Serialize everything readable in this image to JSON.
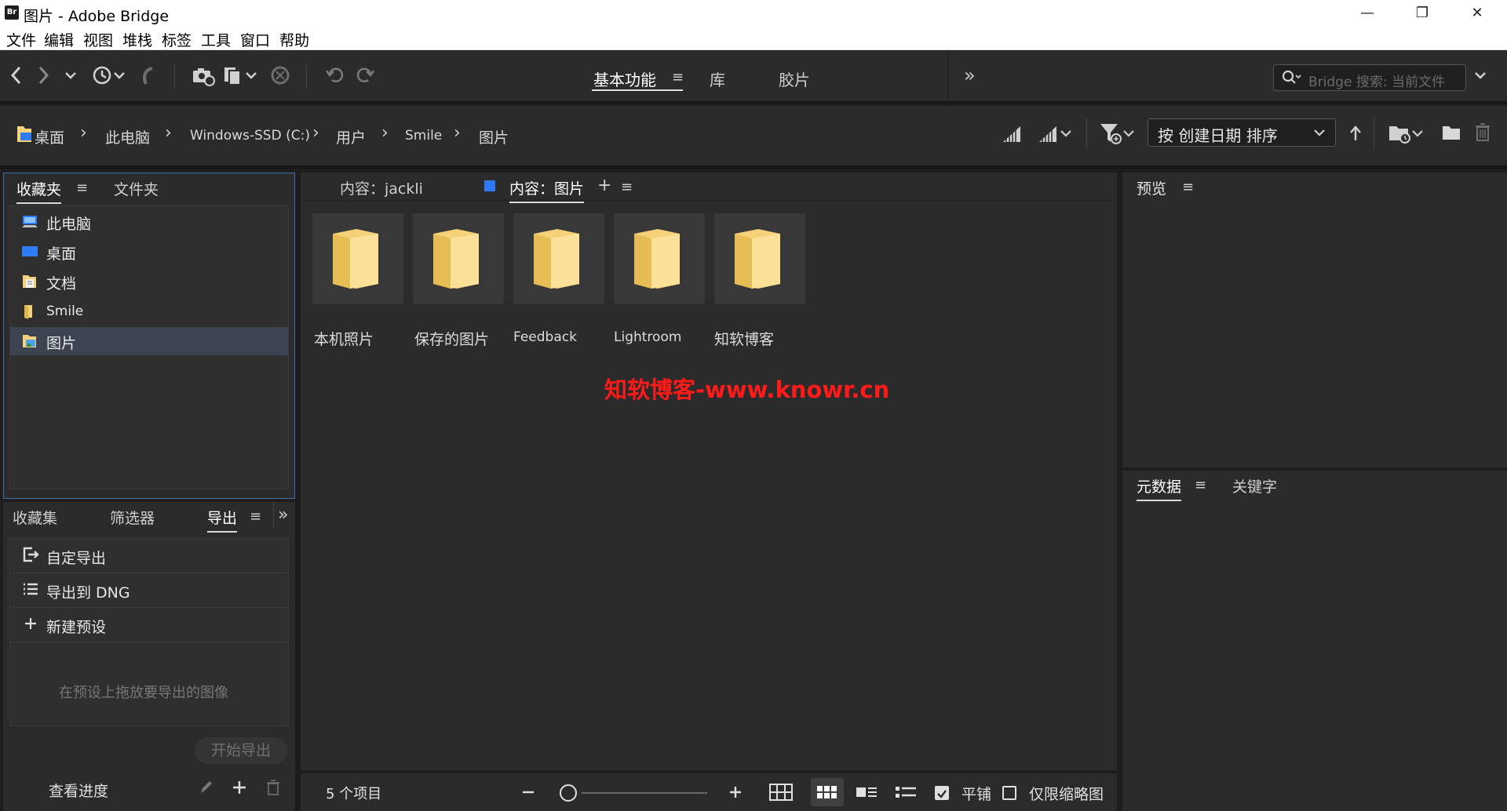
{
  "window": {
    "app_badge": "Br",
    "title": "图片 - Adobe Bridge",
    "minimize": "—",
    "restore": "❐",
    "close": "✕"
  },
  "menu": [
    "文件",
    "编辑",
    "视图",
    "堆栈",
    "标签",
    "工具",
    "窗口",
    "帮助"
  ],
  "workspaces": {
    "items": [
      "基本功能",
      "库",
      "胶片"
    ],
    "active": "基本功能",
    "more": "»"
  },
  "search": {
    "placeholder": "Bridge 搜索: 当前文件"
  },
  "breadcrumb": [
    "桌面",
    "此电脑",
    "Windows-SSD (C:)",
    "用户",
    "Smile",
    "图片"
  ],
  "sort": {
    "label": "按 创建日期 排序"
  },
  "favorites_panel": {
    "tabs": [
      "收藏夹",
      "文件夹"
    ],
    "items": [
      {
        "label": "此电脑",
        "icon": "computer-icon"
      },
      {
        "label": "桌面",
        "icon": "desktop-icon"
      },
      {
        "label": "文档",
        "icon": "documents-icon"
      },
      {
        "label": "Smile",
        "icon": "user-folder-icon"
      },
      {
        "label": "图片",
        "icon": "pictures-icon"
      }
    ],
    "selected": "图片"
  },
  "export_panel": {
    "tabs": [
      "收藏集",
      "筛选器",
      "导出"
    ],
    "active": "导出",
    "rows": [
      {
        "label": "自定导出",
        "icon": "export-icon"
      },
      {
        "label": "导出到 DNG",
        "icon": "list-icon"
      },
      {
        "label": "新建预设",
        "icon": "plus-icon"
      }
    ],
    "hint": "在预设上拖放要导出的图像",
    "start_button": "开始导出",
    "progress": "查看进度"
  },
  "content_panel": {
    "tabs": [
      "内容：jackli",
      "内容：图片"
    ],
    "items": [
      "本机照片",
      "保存的图片",
      "Feedback",
      "Lightroom",
      "知软博客"
    ],
    "watermark": "知软博客-www.knowr.cn"
  },
  "statusbar": {
    "count": "5 个项目",
    "tile_label": "平铺",
    "tile_checked": true,
    "thumbs_only_label": "仅限缩略图",
    "thumbs_only_checked": false
  },
  "preview_panel": {
    "tab": "预览"
  },
  "metadata_panel": {
    "tabs": [
      "元数据",
      "关键字"
    ]
  },
  "colors": {
    "folder": "#f5d27a",
    "accent_blue": "#2f7bf5",
    "watermark": "#ff1a1a"
  }
}
